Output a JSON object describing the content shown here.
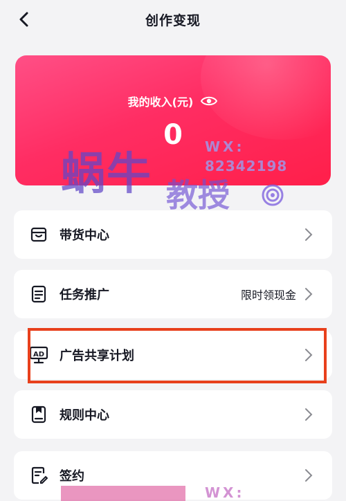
{
  "header": {
    "title": "创作变现",
    "back_icon": "chevron-left-icon"
  },
  "income": {
    "label": "我的收入(元)",
    "value": "0",
    "eye_icon": "eye-icon"
  },
  "menu": [
    {
      "key": "goods",
      "label": "带货中心",
      "extra": "",
      "icon": "shop-bag-icon"
    },
    {
      "key": "tasks",
      "label": "任务推广",
      "extra": "限时领现金",
      "icon": "document-icon"
    },
    {
      "key": "ads",
      "label": "广告共享计划",
      "extra": "",
      "icon": "ad-monitor-icon"
    },
    {
      "key": "rules",
      "label": "规则中心",
      "extra": "",
      "icon": "bookmark-icon"
    },
    {
      "key": "sign",
      "label": "签约",
      "extra": "",
      "icon": "contract-pen-icon"
    }
  ],
  "watermark": {
    "brand": "蜗牛",
    "brand_sub": "教授",
    "wx_label": "WX:",
    "wx_number": "82342198",
    "bottom_wx_label": "WX:"
  },
  "colors": {
    "card_gradient_start": "#ff4f86",
    "card_gradient_end": "#ff1f4a",
    "highlight_border": "#e8401c",
    "background": "#f3f3f5",
    "text": "#161823"
  }
}
